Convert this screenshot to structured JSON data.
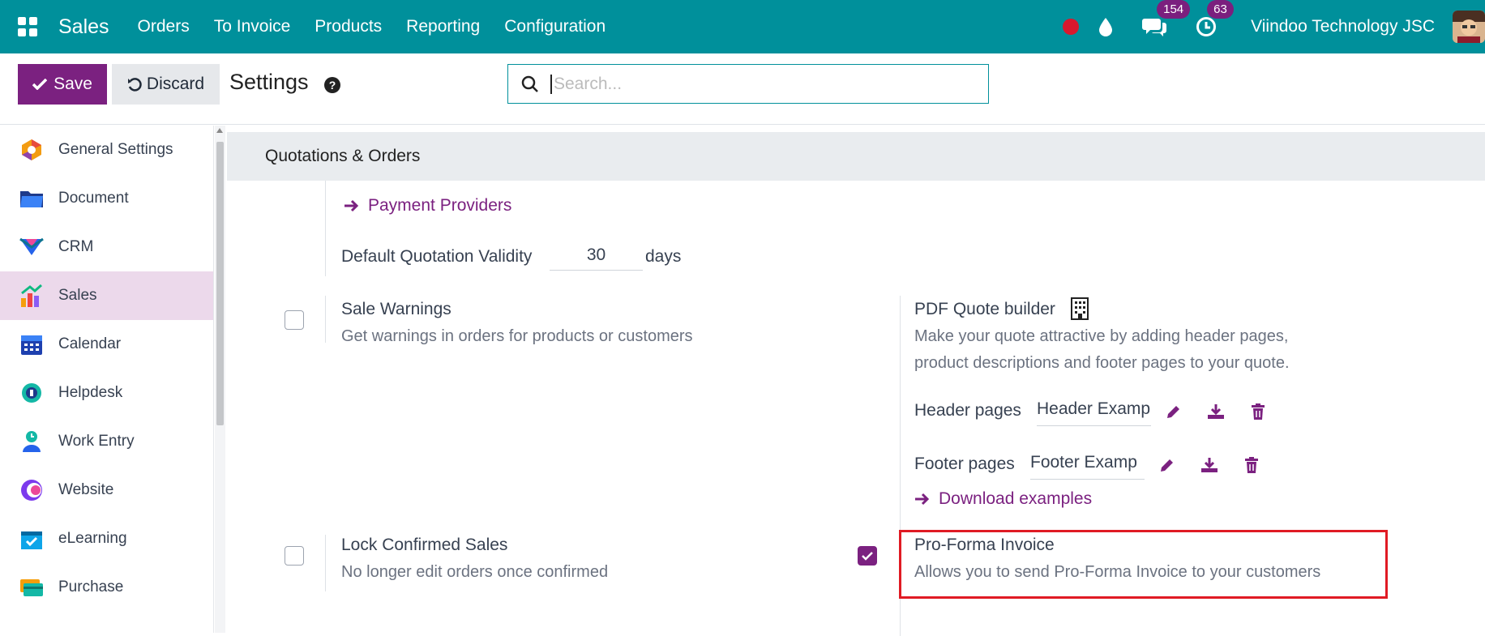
{
  "navbar": {
    "app_name": "Sales",
    "menu": [
      "Orders",
      "To Invoice",
      "Products",
      "Reporting",
      "Configuration"
    ],
    "messages_count": "154",
    "activities_count": "63",
    "company": "Viindoo Technology JSC"
  },
  "control": {
    "save_label": "Save",
    "discard_label": "Discard",
    "title": "Settings",
    "search_placeholder": "Search..."
  },
  "sidebar": {
    "items": [
      {
        "label": "General Settings",
        "icon": "settings-hexagon-icon"
      },
      {
        "label": "Document",
        "icon": "folder-icon"
      },
      {
        "label": "CRM",
        "icon": "crm-icon"
      },
      {
        "label": "Sales",
        "icon": "sales-chart-icon"
      },
      {
        "label": "Calendar",
        "icon": "calendar-icon"
      },
      {
        "label": "Helpdesk",
        "icon": "headset-icon"
      },
      {
        "label": "Work Entry",
        "icon": "person-clock-icon"
      },
      {
        "label": "Website",
        "icon": "website-icon"
      },
      {
        "label": "eLearning",
        "icon": "elearning-icon"
      },
      {
        "label": "Purchase",
        "icon": "credit-card-icon"
      }
    ],
    "active": "Sales"
  },
  "main": {
    "section_title": "Quotations & Orders",
    "payment_providers_link": "Payment Providers",
    "validity": {
      "label": "Default Quotation Validity",
      "value": "30",
      "unit": "days"
    },
    "sale_warnings": {
      "title": "Sale Warnings",
      "desc": "Get warnings in orders for products or customers",
      "checked": false
    },
    "pdf_quote": {
      "title": "PDF Quote builder",
      "desc_line1": "Make your quote attractive by adding header pages,",
      "desc_line2": "product descriptions and footer pages to your quote.",
      "header_label": "Header pages",
      "header_value": "Header Examp",
      "footer_label": "Footer pages",
      "footer_value": "Footer Examp",
      "download_link": "Download examples"
    },
    "lock_confirmed": {
      "title": "Lock Confirmed Sales",
      "desc": "No longer edit orders once confirmed",
      "checked": false
    },
    "pro_forma": {
      "title": "Pro-Forma Invoice",
      "desc": "Allows you to send Pro-Forma Invoice to your customers",
      "checked": true
    }
  },
  "colors": {
    "navbar": "#00909b",
    "primary": "#7b2180",
    "highlight": "#e01b24"
  }
}
